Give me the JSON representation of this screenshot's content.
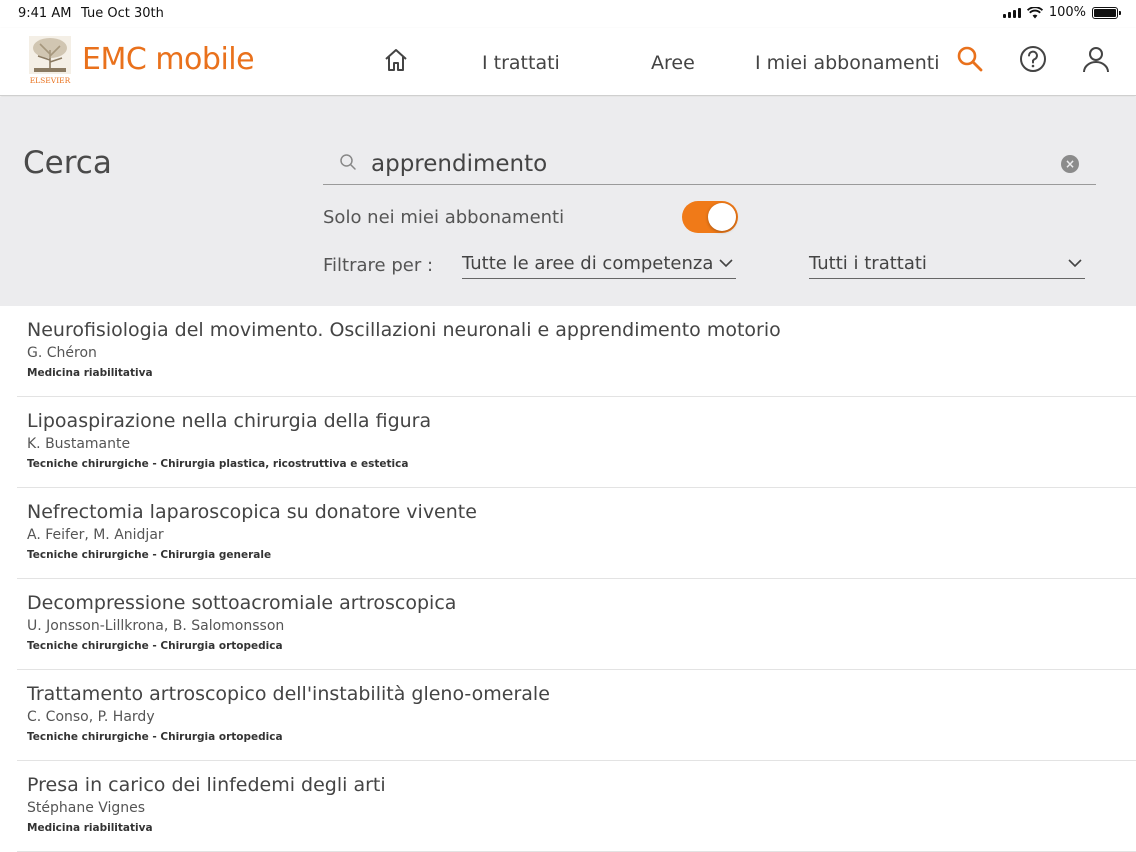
{
  "status": {
    "time": "9:41 AM",
    "date": "Tue Oct 30th",
    "battery": "100%"
  },
  "nav": {
    "brand": "EMC mobile",
    "logo_text": "ELSEVIER",
    "items": [
      {
        "label": "I trattati"
      },
      {
        "label": "Aree"
      },
      {
        "label": "I miei abbonamenti"
      }
    ],
    "accent_color": "#e9711c"
  },
  "search": {
    "title": "Cerca",
    "query": "apprendimento",
    "clear_glyph": "×",
    "toggle_label": "Solo nei miei abbonamenti",
    "toggle_on": true,
    "filter_label": "Filtrare per :",
    "area_select": "Tutte le aree di competenza",
    "treatise_select": "Tutti i trattati"
  },
  "results": [
    {
      "title": "Neurofisiologia del movimento. Oscillazioni neuronali e apprendimento motorio",
      "authors": "G. Chéron",
      "area": "Medicina riabilitativa"
    },
    {
      "title": "Lipoaspirazione nella chirurgia della figura",
      "authors": "K. Bustamante",
      "area": "Tecniche chirurgiche - Chirurgia plastica, ricostruttiva e estetica"
    },
    {
      "title": "Nefrectomia laparoscopica su donatore vivente",
      "authors": "A. Feifer, M. Anidjar",
      "area": "Tecniche chirurgiche - Chirurgia generale"
    },
    {
      "title": "Decompressione sottoacromiale artroscopica",
      "authors": "U. Jonsson-Lillkrona, B. Salomonsson",
      "area": "Tecniche chirurgiche - Chirurgia ortopedica"
    },
    {
      "title": "Trattamento artroscopico dell'instabilità gleno-omerale",
      "authors": "C. Conso, P. Hardy",
      "area": "Tecniche chirurgiche - Chirurgia ortopedica"
    },
    {
      "title": "Presa in carico dei linfedemi degli arti",
      "authors": "Stéphane Vignes",
      "area": "Medicina riabilitativa"
    }
  ]
}
